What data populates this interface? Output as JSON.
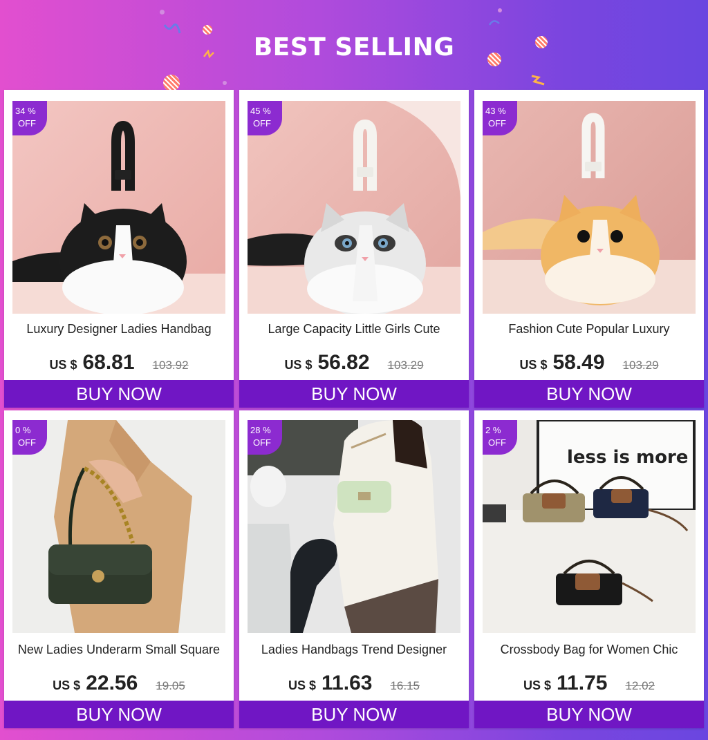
{
  "header": {
    "title": "BEST SELLING"
  },
  "products": [
    {
      "discount": "34 %",
      "off": "OFF",
      "title": "Luxury Designer Ladies Handbag",
      "currency": "US $",
      "price": "68.81",
      "old_price": "103.92",
      "buy_label": "BUY NOW"
    },
    {
      "discount": "45 %",
      "off": "OFF",
      "title": "Large Capacity Little Girls Cute",
      "currency": "US $",
      "price": "56.82",
      "old_price": "103.29",
      "buy_label": "BUY NOW"
    },
    {
      "discount": "43 %",
      "off": "OFF",
      "title": "Fashion Cute Popular Luxury",
      "currency": "US $",
      "price": "58.49",
      "old_price": "103.29",
      "buy_label": "BUY NOW"
    },
    {
      "discount": "0 %",
      "off": "OFF",
      "title": "New Ladies Underarm Small Square",
      "currency": "US $",
      "price": "22.56",
      "old_price": "19.05",
      "buy_label": "BUY NOW"
    },
    {
      "discount": "28 %",
      "off": "OFF",
      "title": "Ladies Handbags Trend Designer",
      "currency": "US $",
      "price": "11.63",
      "old_price": "16.15",
      "buy_label": "BUY NOW"
    },
    {
      "discount": "2 %",
      "off": "OFF",
      "title": "Crossbody Bag for Women Chic",
      "currency": "US $",
      "price": "11.75",
      "old_price": "12.02",
      "buy_label": "BUY NOW"
    }
  ],
  "images": {
    "poster_text": "less is more"
  },
  "colors": {
    "accent": "#7016c4",
    "badge": "#8c2bd0",
    "background_left": "#e24fcf",
    "background_right": "#6a46e0"
  }
}
